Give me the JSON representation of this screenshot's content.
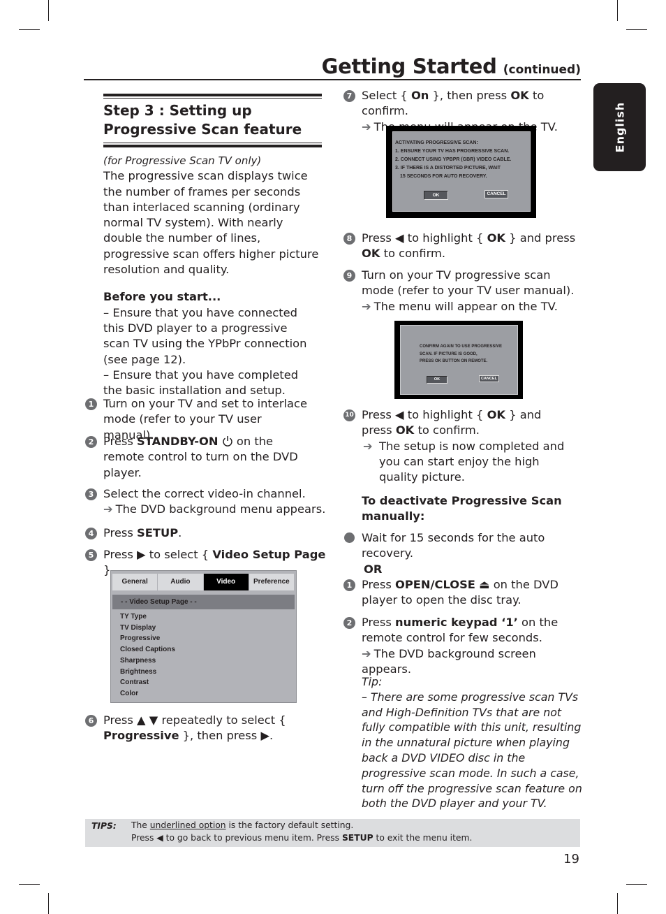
{
  "header": {
    "title": "Getting Started",
    "subtitle": "(continued)"
  },
  "language_tab": "English",
  "section": {
    "heading_line1": "Step 3 : Setting up",
    "heading_line2": "Progressive Scan feature",
    "note": "(for Progressive Scan TV only)",
    "intro": "The progressive scan displays twice the number of frames per seconds than interlaced scanning (ordinary normal TV system). With nearly double the number of lines, progressive scan offers higher picture resolution and quality.",
    "before_title": "Before you start...",
    "before_1": "– Ensure that you have connected this DVD player to a progressive scan TV using the YPbPr connection (see page 12).",
    "before_2": "– Ensure that you have completed the basic installation and setup."
  },
  "steps": {
    "s1": {
      "num": "1",
      "text": "Turn on your TV and set to interlace mode (refer to your TV user manual)."
    },
    "s2": {
      "num": "2",
      "pre": "Press ",
      "bold": "STANDBY-ON",
      "icon": "power-icon",
      "post": " on the remote control to turn on the DVD player."
    },
    "s3": {
      "num": "3",
      "text": "Select the correct video-in channel.",
      "result": "The DVD background menu appears."
    },
    "s4": {
      "num": "4",
      "pre": "Press ",
      "bold": "SETUP",
      "post": "."
    },
    "s5": {
      "num": "5",
      "pre": "Press ",
      "icon": "right-arrow-icon",
      "mid": " to select { ",
      "bold": "Video Setup Page",
      "post": " }."
    },
    "s6": {
      "num": "6",
      "pre": "Press ",
      "icons": "up-down-arrow-icons",
      "mid": " repeatedly to select { ",
      "bold": "Progressive",
      "post": " }, then press ",
      "icon": "right-arrow-icon",
      "end": "."
    },
    "s7": {
      "num": "7",
      "pre": "Select { ",
      "bold1": "On",
      "mid": " }, then press ",
      "bold2": "OK",
      "post": " to confirm.",
      "result": "The menu will appear on the TV."
    },
    "s8": {
      "num": "8",
      "pre": "Press ",
      "icon": "left-arrow-icon",
      "mid": " to highlight { ",
      "bold1": "OK",
      "mid2": " } and press ",
      "bold2": "OK",
      "post": " to confirm."
    },
    "s9": {
      "num": "9",
      "text": "Turn on your TV progressive scan mode (refer to your TV user manual).",
      "result": "The menu will appear on the TV."
    },
    "s10": {
      "num": "10",
      "pre": "Press ",
      "icon": "left-arrow-icon",
      "mid": " to highlight { ",
      "bold1": "OK",
      "mid2": " } and press ",
      "bold2": "OK",
      "post": " to confirm.",
      "result": "The setup is now completed and you can start enjoy the high quality picture."
    }
  },
  "setup_menu": {
    "tabs": [
      "General",
      "Audio",
      "Video",
      "Preference"
    ],
    "active_tab": "Video",
    "page_title": "- -  Video Setup Page  - -",
    "items": [
      "TY Type",
      "TV Display",
      "Progressive",
      "Closed Captions",
      "Sharpness",
      "Brightness",
      "Contrast",
      "Color"
    ]
  },
  "tv_dialog_1": {
    "lines": [
      "ACTIVATING PROGRESSIVE SCAN:",
      "1. ENSURE YOUR TV HAS PROGRESSIVE SCAN.",
      "2. CONNECT USING YPBPR (GBR) VIDEO CABLE.",
      "3. IF THERE IS A DISTORTED PICTURE, WAIT",
      "   15 SECONDS FOR AUTO RECOVERY."
    ],
    "ok": "OK",
    "cancel": "CANCEL"
  },
  "tv_dialog_2": {
    "lines": [
      "CONFIRM AGAIN TO USE PROGRESSIVE",
      "SCAN. IF PICTURE IS GOOD,",
      "PRESS OK BUTTON ON REMOTE."
    ],
    "ok": "OK",
    "cancel": "CANCEL"
  },
  "deactivate": {
    "title": "To deactivate Progressive Scan manually:",
    "bullet": "Wait for 15 seconds for the auto recovery.",
    "or": "OR",
    "d1": {
      "num": "1",
      "pre": "Press ",
      "bold": "OPEN/CLOSE",
      "icon": "eject-icon",
      "post": " on the DVD player to open the disc tray."
    },
    "d2": {
      "num": "2",
      "pre": "Press ",
      "bold": "numeric keypad ‘1’",
      "post": " on the remote control for few seconds.",
      "result": "The DVD background screen appears."
    }
  },
  "tip": {
    "label": "Tip:",
    "text": "– There are some progressive scan TVs and High-Definition TVs that are not fully compatible with this unit, resulting in the unnatural picture when playing back a DVD VIDEO disc in the progressive scan mode. In such a case, turn off the progressive scan feature on both the DVD player and your TV."
  },
  "tips_bar": {
    "label": "TIPS:",
    "l1_pre": "The ",
    "l1_underlined": "underlined option",
    "l1_post": " is the factory default setting.",
    "l2_pre": "Press ",
    "l2_mid": " to go back to previous menu item. Press ",
    "l2_bold": "SETUP",
    "l2_post": " to exit the menu item."
  },
  "page_number": "19",
  "colors": {
    "text": "#231f20",
    "step_circle": "#6d6e71",
    "tips_bg": "#dcdddf",
    "menu_bg": "#b2b3b8",
    "tv_bg": "#9c9ea3"
  }
}
